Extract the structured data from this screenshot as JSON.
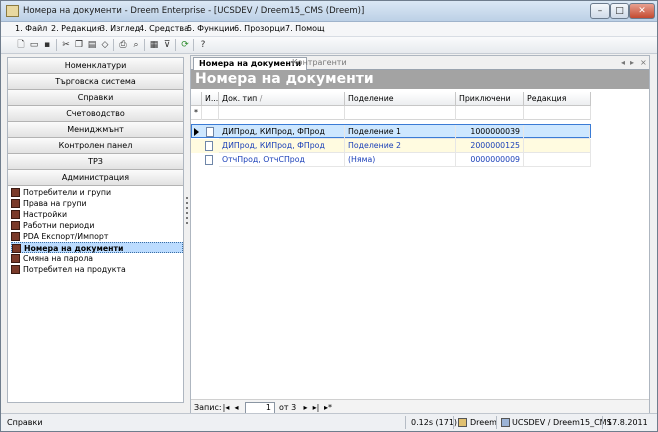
{
  "window": {
    "title": "Номера на документи - Dreem Enterprise - [UCSDEV / Dreem15_CMS (Dreem)]"
  },
  "menu": [
    {
      "label": "1. Файл"
    },
    {
      "label": "2. Редакция"
    },
    {
      "label": "3. Изглед"
    },
    {
      "label": "4. Средства"
    },
    {
      "label": "5. Функции"
    },
    {
      "label": "6. Прозорци"
    },
    {
      "label": "7. Помощ"
    }
  ],
  "toolbar_icons": [
    "new-icon",
    "open-icon",
    "save-icon",
    "cut-icon",
    "copy-icon",
    "paste-icon",
    "clear-icon",
    "print-icon",
    "print-preview-icon",
    "view-icon",
    "filter-icon",
    "refresh-icon",
    "help-icon"
  ],
  "nav": {
    "sections": [
      {
        "label": "Номенклатури"
      },
      {
        "label": "Търговска система"
      },
      {
        "label": "Справки"
      },
      {
        "label": "Счетоводство"
      },
      {
        "label": "Мениджмънт"
      },
      {
        "label": "Контролен панел"
      },
      {
        "label": "ТРЗ"
      },
      {
        "label": "Администрация"
      }
    ],
    "items": [
      {
        "label": "Потребители и групи"
      },
      {
        "label": "Права на групи"
      },
      {
        "label": "Настройки"
      },
      {
        "label": "Работни периоди"
      },
      {
        "label": "PDA Експорт/Импорт"
      },
      {
        "label": "Номера на документи",
        "selected": true
      },
      {
        "label": "Смяна на парола"
      },
      {
        "label": "Потребител на продукта"
      }
    ]
  },
  "tabs": [
    {
      "label": "Номера на документи",
      "active": true
    },
    {
      "label": "Контрагенти",
      "active": false
    }
  ],
  "tab_nav": {
    "left": "◂",
    "right": "▸",
    "close": "×"
  },
  "page_header": "Номера на документи",
  "grid": {
    "columns": [
      "И...",
      "Док. тип",
      "Поделение",
      "Приключени",
      "Редакция"
    ],
    "new_row_marker": "*",
    "rows": [
      {
        "doc_type": "ДИПрод, КИПрод, ФПрод",
        "division": "Поделение 1",
        "closed": "1000000039",
        "edit": ""
      },
      {
        "doc_type": "ДИПрод, КИПрод, ФПрод",
        "division": "Поделение 2",
        "closed": "2000000125",
        "edit": ""
      },
      {
        "doc_type": "ОтчПрод, ОтчСПрод",
        "division": "(Няма)",
        "closed": "0000000009",
        "edit": ""
      }
    ]
  },
  "record_nav": {
    "label": "Запис:",
    "current": "1",
    "of_text": "от 3"
  },
  "status": {
    "left": "Справки",
    "timing": "0.12s (171)",
    "user": "Dreem",
    "db": "UCSDEV / Dreem15_CMS",
    "date": "17.8.2011"
  }
}
